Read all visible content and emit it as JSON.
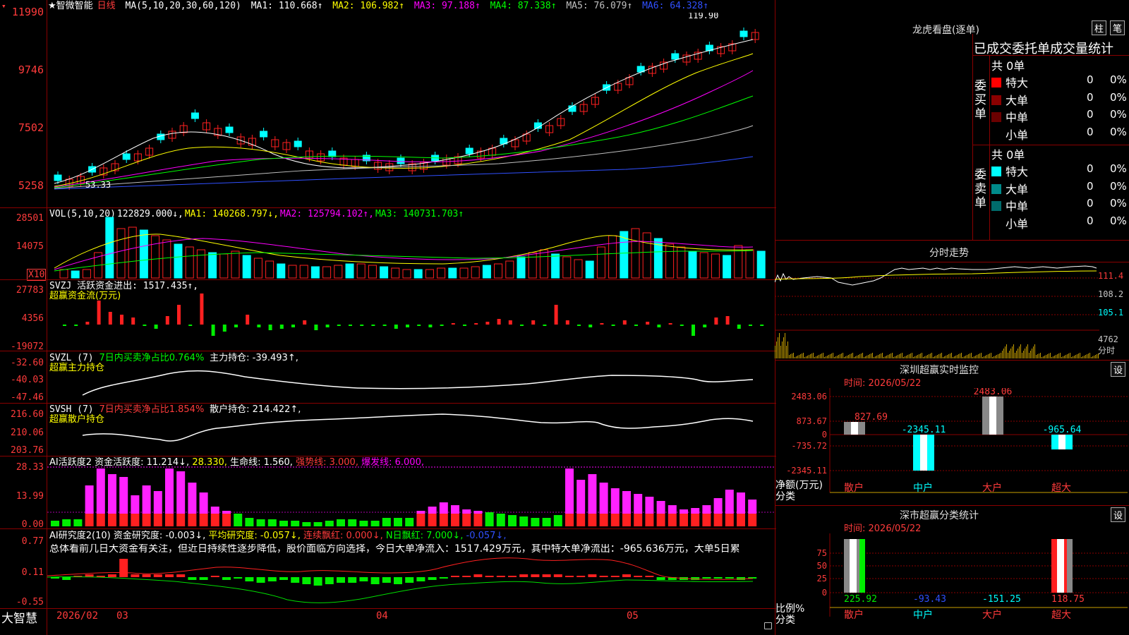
{
  "header": {
    "title": "★智微智能",
    "period": "日线",
    "ma_label": "MA(5,10,20,30,60,120)",
    "ma": [
      {
        "label": "MA1: 110.668↑",
        "color": "#ffffff"
      },
      {
        "label": "MA2: 106.982↑",
        "color": "#ffff00"
      },
      {
        "label": "MA3: 97.188↑",
        "color": "#ff00ff"
      },
      {
        "label": "MA4: 87.338↑",
        "color": "#00ff00"
      },
      {
        "label": "MA5: 76.079↑",
        "color": "#c0c0c0"
      },
      {
        "label": "MA6: 64.328↑",
        "color": "#0000ff"
      }
    ],
    "high_label": "119.90",
    "low_label": "53.33"
  },
  "axes": {
    "main": [
      "11990",
      "9746",
      "7502",
      "5258"
    ],
    "vol": [
      "28501",
      "14075"
    ],
    "vol_mult": "X10",
    "svzj": [
      "27783",
      "4356",
      "-19072"
    ],
    "svzl": [
      "-32.60",
      "-40.03",
      "-47.46"
    ],
    "svsh": [
      "216.60",
      "210.06",
      "203.76"
    ],
    "ai1": [
      "28.33",
      "13.99",
      "0.00"
    ],
    "ai2": [
      "0.77",
      "0.11",
      "-0.55"
    ],
    "dates": [
      "2026/02",
      "03",
      "04",
      "05"
    ]
  },
  "vol": {
    "name": "VOL(5,10,20)",
    "value": "122829.000↓,",
    "ma1": "MA1: 140268.797↓,",
    "ma2": "MA2: 125794.102↑,",
    "ma3": "MA3: 140731.703↑"
  },
  "svzj": {
    "line1": "SVZJ  活跃资金进出: 1517.435↑,",
    "line2": "超赢资金流(万元)"
  },
  "svzl": {
    "name": "SVZL (7)",
    "ratio": "7日内买卖净占比0.764%",
    "hold": "主力持仓: -39.493↑,",
    "line2": "超赢主力持仓"
  },
  "svsh": {
    "name": "SVSH (7)",
    "ratio": "7日内买卖净占比1.854%",
    "hold": "散户持仓: 214.422↑,",
    "line2": "超赢散户持仓"
  },
  "ai1": {
    "name": "AI活跃度2",
    "a": "资金活跃度: 11.214↓,",
    "b": "28.330,",
    "c": "生命线: 1.560,",
    "d": "强势线: 3.000,",
    "e": "爆发线: 6.000,"
  },
  "ai2": {
    "name": "AI研究度2(10)",
    "a": "资金研究度: -0.003↓,",
    "b": "平均研究度: -0.057↓,",
    "c": "连续飘红: 0.000↓,",
    "d": "N日飘红: 7.000↓,",
    "e": "-0.057↓,",
    "summary": "总体看前几日大资金有关注，但近日持续性逐步降低，股价面临方向选择，今日大单净流入：1517.429万元，其中特大单净流出：-965.636万元，大单5日累"
  },
  "footer": {
    "brand": "大智慧"
  },
  "longhu": {
    "title": "龙虎看盘(逐单)",
    "btn1": "柱",
    "btn2": "笔",
    "tabs": "已成交委托单成交量统计",
    "buy_label": "委买单",
    "sell_label": "委卖单",
    "buy_total": "共 0单",
    "sell_total": "共 0单",
    "buy_rows": [
      {
        "name": "特大",
        "a": "0",
        "b": "0%",
        "color": "#ff0000"
      },
      {
        "name": "大单",
        "a": "0",
        "b": "0%",
        "color": "#8b0000"
      },
      {
        "name": "中单",
        "a": "0",
        "b": "0%",
        "color": "#6b0000"
      },
      {
        "name": "小单",
        "a": "0",
        "b": "0%",
        "color": ""
      }
    ],
    "sell_rows": [
      {
        "name": "特大",
        "a": "0",
        "b": "0%",
        "color": "#00ffff"
      },
      {
        "name": "大单",
        "a": "0",
        "b": "0%",
        "color": "#008b8b"
      },
      {
        "name": "中单",
        "a": "0",
        "b": "0%",
        "color": "#006b6b"
      },
      {
        "name": "小单",
        "a": "0",
        "b": "0%",
        "color": ""
      }
    ]
  },
  "intraday": {
    "title": "分时走势",
    "y": [
      "111.4",
      "108.2",
      "105.1"
    ],
    "vol": "4762",
    "unit": "分时"
  },
  "monitor": {
    "title": "深圳超赢实时监控",
    "btn": "设",
    "time": "时间: 2026/05/22",
    "ylabels": [
      "2483.06",
      "873.67",
      "0",
      "-735.72",
      "-2345.11"
    ],
    "ylabel": "净额(万元)",
    "xlabel": "分类",
    "cats": [
      "散户",
      "中户",
      "大户",
      "超大"
    ],
    "values": [
      827.69,
      -2345.11,
      2483.06,
      -965.64
    ],
    "value_labels": [
      "827.69",
      "-2345.11",
      "2483.06",
      "-965.64"
    ]
  },
  "classify": {
    "title": "深市超赢分类统计",
    "btn": "设",
    "time": "时间: 2026/05/22",
    "ylabels": [
      "75",
      "50",
      "25",
      "0"
    ],
    "ylabel": "比例%",
    "xlabel": "分类",
    "cats": [
      "散户",
      "中户",
      "大户",
      "超大"
    ],
    "value_labels": [
      "225.92",
      "-93.43",
      "-151.25",
      "118.75"
    ]
  }
}
